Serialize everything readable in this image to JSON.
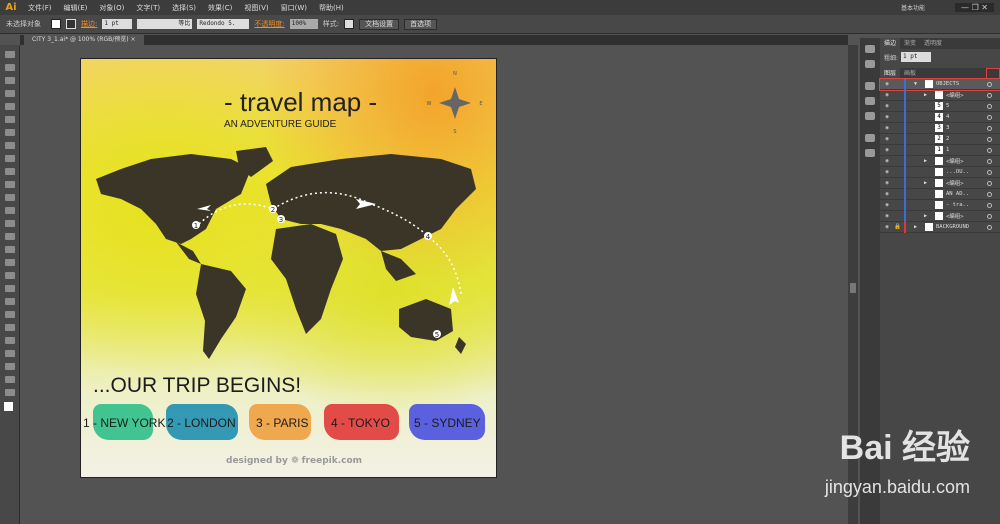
{
  "app": {
    "logo": "Ai",
    "menus": [
      "文件(F)",
      "编辑(E)",
      "对象(O)",
      "文字(T)",
      "选择(S)",
      "效果(C)",
      "视图(V)",
      "窗口(W)",
      "帮助(H)"
    ],
    "workspace": "基本功能"
  },
  "control": {
    "selection": "未选择对象",
    "stroke_label": "描边:",
    "stroke_value": "1 pt",
    "profile": "等比",
    "brush": "Redondo 5.",
    "opacity_label": "不透明度:",
    "opacity_value": "100%",
    "style_label": "样式:",
    "doc_setup": "文档设置",
    "prefs": "首选项"
  },
  "doc_tab": {
    "title": "CITY 3_1.ai* @ 100% (RGB/预览)",
    "close": "×"
  },
  "artwork": {
    "title": "- travel map -",
    "subtitle": "AN ADVENTURE GUIDE",
    "begins": "...OUR TRIP BEGINS!",
    "cities": [
      {
        "label": "1 - NEW YORK",
        "color": "#2dbf8a"
      },
      {
        "label": "2 - LONDON",
        "color": "#1e8fb0"
      },
      {
        "label": "3 - PARIS",
        "color": "#f0a040"
      },
      {
        "label": "4 - TOKYO",
        "color": "#e03838"
      },
      {
        "label": "5 - SYDNEY",
        "color": "#4a50e0"
      }
    ],
    "stops": [
      "1",
      "2",
      "3",
      "4",
      "5"
    ],
    "credit": "designed by ❁ freepik.com",
    "compass": [
      "N",
      "S",
      "W",
      "E"
    ]
  },
  "panel": {
    "tabs": [
      "描边",
      "渐变",
      "透明度"
    ],
    "weight_label": "粗细:",
    "weight_value": "1 pt",
    "layer_tabs": [
      "图层",
      "画板"
    ],
    "layers": [
      {
        "name": "OBJECTS",
        "thumb": "",
        "expanded": true
      },
      {
        "name": "<编组>",
        "thumb": ""
      },
      {
        "name": "5",
        "thumb": "5"
      },
      {
        "name": "4",
        "thumb": "4"
      },
      {
        "name": "3",
        "thumb": "3"
      },
      {
        "name": "2",
        "thumb": "2"
      },
      {
        "name": "1",
        "thumb": "1"
      },
      {
        "name": "<编组>",
        "thumb": ""
      },
      {
        "name": "...OU..",
        "thumb": ""
      },
      {
        "name": "<编组>",
        "thumb": ""
      },
      {
        "name": "AN AD..",
        "thumb": ""
      },
      {
        "name": "- tra..",
        "thumb": ""
      },
      {
        "name": "<编组>",
        "thumb": ""
      },
      {
        "name": "BACKGROUND",
        "thumb": ""
      }
    ]
  },
  "watermark": {
    "brand": "Bai 经验",
    "url": "jingyan.baidu.com"
  }
}
